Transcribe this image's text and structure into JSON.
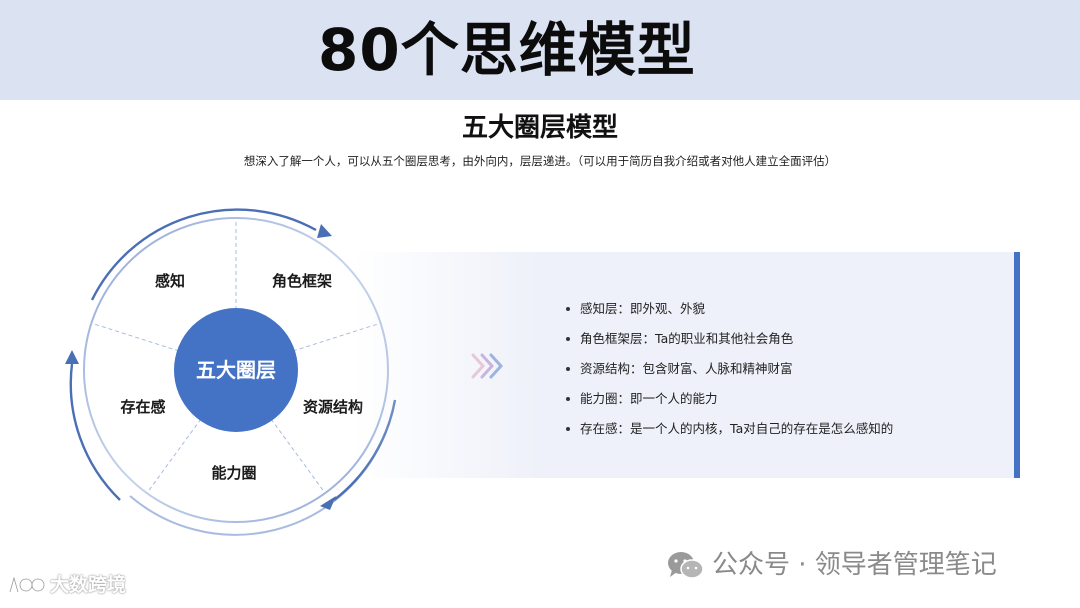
{
  "header": {
    "title": "80个思维模型"
  },
  "model": {
    "title": "五大圈层模型",
    "subtitle": "想深入了解一个人，可以从五个圈层思考，由外向内，层层递进。（可以用于简历自我介绍或者对他人建立全面评估）"
  },
  "diagram": {
    "center": "五大圈层",
    "segments": [
      "感知",
      "角色框架",
      "资源结构",
      "能力圈",
      "存在感"
    ],
    "colors": {
      "center": "#4472c4",
      "ring": "#a9bbe0",
      "arrow": "#4a6fb5",
      "divider": "#a9bbe0"
    }
  },
  "panel": {
    "bullets": [
      "感知层：即外观、外貌",
      "角色框架层：Ta的职业和其他社会角色",
      "资源结构：包含财富、人脉和精神财富",
      "能力圈：即一个人的能力",
      "存在感：是一个人的内核，Ta对自己的存在是怎么感知的"
    ],
    "accent": "#4472c4"
  },
  "watermarks": {
    "right": "公众号 · 领导者管理笔记",
    "left": "大数跨境",
    "right_icon": "wechat-icon",
    "left_icon": "brand-logo-icon"
  }
}
